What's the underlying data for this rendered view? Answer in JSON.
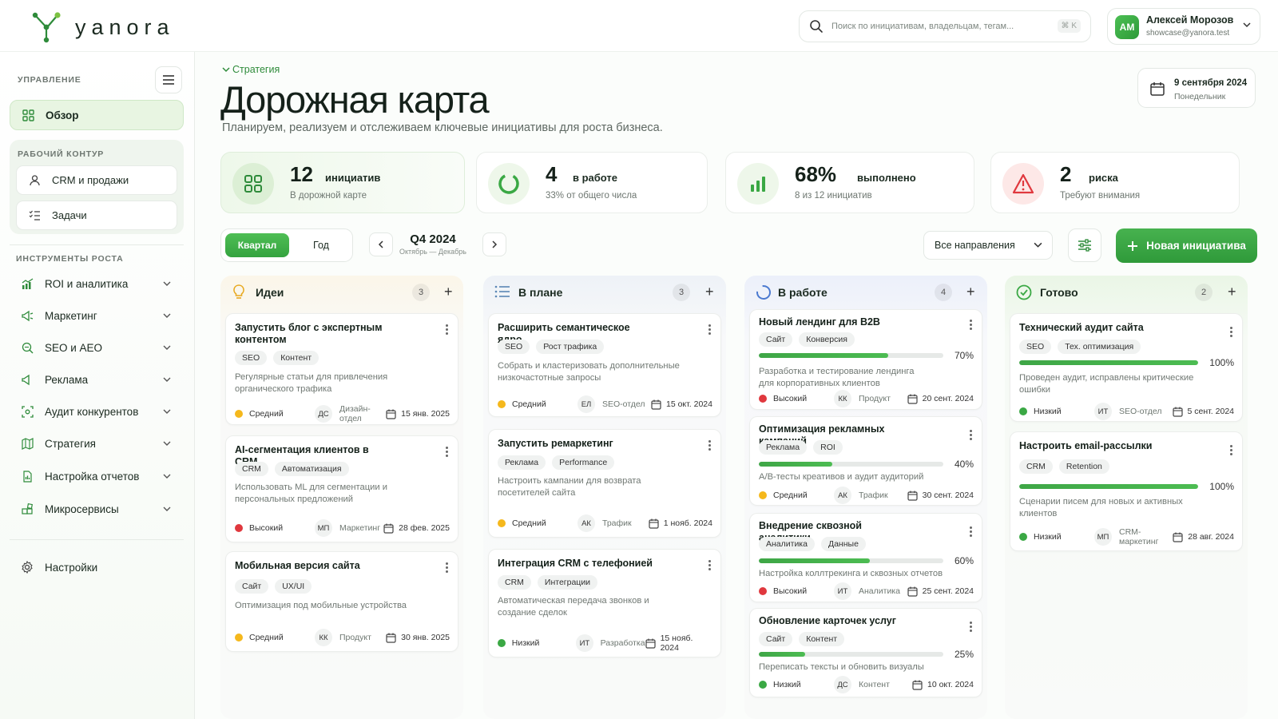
{
  "brand": {
    "name": "yanora"
  },
  "search": {
    "placeholder": "Поиск по инициативам, владельцам, тегам...",
    "shortcut": "⌘ K"
  },
  "user": {
    "initials": "АМ",
    "name": "Алексей Морозов",
    "email": "showcase@yanora.test"
  },
  "sidebar": {
    "section_manage": "УПРАВЛЕНИЕ",
    "overview": "Обзор",
    "section_work": "РАБОЧИЙ КОНТУР",
    "work_items": [
      {
        "label": "CRM и продажи",
        "icon": "user-icon"
      },
      {
        "label": "Задачи",
        "icon": "checklist-icon"
      }
    ],
    "section_tools": "ИНСТРУМЕНТЫ РОСТА",
    "tools": [
      {
        "label": "ROI и аналитика",
        "icon": "analytics-icon"
      },
      {
        "label": "Маркетинг",
        "icon": "megaphone-icon"
      },
      {
        "label": "SEO и AEO",
        "icon": "seo-search-icon"
      },
      {
        "label": "Реклама",
        "icon": "ads-icon"
      },
      {
        "label": "Аудит конкурентов",
        "icon": "scan-icon"
      },
      {
        "label": "Стратегия",
        "icon": "map-icon"
      },
      {
        "label": "Настройка отчетов",
        "icon": "report-icon"
      },
      {
        "label": "Микросервисы",
        "icon": "blocks-icon"
      }
    ],
    "settings": "Настройки"
  },
  "header": {
    "breadcrumb": "Стратегия",
    "title": "Дорожная карта",
    "subtitle": "Планируем, реализуем и отслеживаем ключевые инициативы для роста бизнеса.",
    "date": "9 сентября 2024",
    "weekday": "Понедельник"
  },
  "stats": [
    {
      "value": "12",
      "label": "инициатив",
      "sub": "В дорожной карте"
    },
    {
      "value": "4",
      "label": "в работе",
      "sub": "33% от общего числа"
    },
    {
      "value": "68%",
      "label": "выполнено",
      "sub": "8 из 12 инициатив"
    },
    {
      "value": "2",
      "label": "риска",
      "sub": "Требуют внимания"
    }
  ],
  "controls": {
    "quarter": "Квартал",
    "year": "Год",
    "period": "Q4 2024",
    "period_range": "Октябрь — Декабрь",
    "direction": "Все направления",
    "new_initiative": "Новая инициатива"
  },
  "colors": {
    "accent": "#3aa844",
    "high": "#e0383e",
    "medium": "#f5b81c",
    "low": "#3aa844"
  },
  "columns": [
    {
      "title": "Идеи",
      "count": "3",
      "cards": [
        {
          "title": "Запустить блог с экспертным контентом",
          "tags": [
            "SEO",
            "Контент"
          ],
          "desc": "Регулярные статьи для привлечения органического трафика",
          "priority": "Средний",
          "initials": "ДС",
          "owner": "Дизайн-отдел",
          "date": "15 янв. 2025"
        },
        {
          "title": "AI-сегментация клиентов в CRM",
          "tags": [
            "CRM",
            "Автоматизация"
          ],
          "desc": "Использовать ML для сегментации и персональных предложений",
          "priority": "Высокий",
          "initials": "МП",
          "owner": "Маркетинг",
          "date": "28 фев. 2025"
        },
        {
          "title": "Мобильная версия сайта",
          "tags": [
            "Сайт",
            "UX/UI"
          ],
          "desc": "Оптимизация под мобильные устройства",
          "priority": "Средний",
          "initials": "КК",
          "owner": "Продукт",
          "date": "30 янв. 2025"
        }
      ]
    },
    {
      "title": "В плане",
      "count": "3",
      "cards": [
        {
          "title": "Расширить семантическое ядро",
          "tags": [
            "SEO",
            "Рост трафика"
          ],
          "desc": "Собрать и кластеризовать дополнительные низкочастотные запросы",
          "priority": "Средний",
          "initials": "ЕЛ",
          "owner": "SEO-отдел",
          "date": "15 окт. 2024"
        },
        {
          "title": "Запустить ремаркетинг",
          "tags": [
            "Реклама",
            "Performance"
          ],
          "desc": "Настроить кампании для возврата посетителей сайта",
          "priority": "Средний",
          "initials": "АК",
          "owner": "Трафик",
          "date": "1 нояб. 2024"
        },
        {
          "title": "Интеграция CRM с телефонией",
          "tags": [
            "CRM",
            "Интеграции"
          ],
          "desc": "Автоматическая передача звонков и создание сделок",
          "priority": "Низкий",
          "initials": "ИТ",
          "owner": "Разработка",
          "date": "15 нояб. 2024"
        }
      ]
    },
    {
      "title": "В работе",
      "count": "4",
      "cards": [
        {
          "title": "Новый лендинг для B2B",
          "tags": [
            "Сайт",
            "Конверсия"
          ],
          "progress": 70,
          "progress_label": "70%",
          "desc": "Разработка и тестирование лендинга для корпоративных клиентов",
          "priority": "Высокий",
          "initials": "КК",
          "owner": "Продукт",
          "date": "20 сент. 2024"
        },
        {
          "title": "Оптимизация рекламных кампаний",
          "tags": [
            "Реклама",
            "ROI"
          ],
          "progress": 40,
          "progress_label": "40%",
          "desc": "A/B-тесты креативов и аудит аудиторий",
          "priority": "Средний",
          "initials": "АК",
          "owner": "Трафик",
          "date": "30 сент. 2024"
        },
        {
          "title": "Внедрение сквозной аналитики",
          "tags": [
            "Аналитика",
            "Данные"
          ],
          "progress": 60,
          "progress_label": "60%",
          "desc": "Настройка коллтрекинга и сквозных отчетов",
          "priority": "Высокий",
          "initials": "ИТ",
          "owner": "Аналитика",
          "date": "25 сент. 2024"
        },
        {
          "title": "Обновление карточек услуг",
          "tags": [
            "Сайт",
            "Контент"
          ],
          "progress": 25,
          "progress_label": "25%",
          "desc": "Переписать тексты и обновить визуалы",
          "priority": "Низкий",
          "initials": "ДС",
          "owner": "Контент",
          "date": "10 окт. 2024"
        }
      ]
    },
    {
      "title": "Готово",
      "count": "2",
      "cards": [
        {
          "title": "Технический аудит сайта",
          "tags": [
            "SEO",
            "Тех. оптимизация"
          ],
          "progress": 100,
          "progress_label": "100%",
          "desc": "Проведен аудит, исправлены критические ошибки",
          "priority": "Низкий",
          "initials": "ИТ",
          "owner": "SEO-отдел",
          "date": "5 сент. 2024"
        },
        {
          "title": "Настроить email-рассылки",
          "tags": [
            "CRM",
            "Retention"
          ],
          "progress": 100,
          "progress_label": "100%",
          "desc": "Сценарии писем для новых и активных клиентов",
          "priority": "Низкий",
          "initials": "МП",
          "owner": "CRM-маркетинг",
          "date": "28 авг. 2024"
        }
      ]
    }
  ]
}
